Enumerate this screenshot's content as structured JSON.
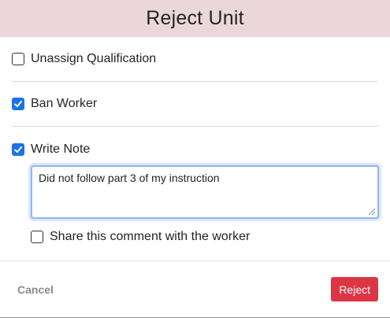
{
  "modal": {
    "title": "Reject Unit"
  },
  "options": {
    "unassign_qualification": {
      "label": "Unassign Qualification",
      "checked": false
    },
    "ban_worker": {
      "label": "Ban Worker",
      "checked": true
    },
    "write_note": {
      "label": "Write Note",
      "checked": true
    }
  },
  "note": {
    "value": "Did not follow part 3 of my instruction"
  },
  "share_comment": {
    "label": "Share this comment with the worker",
    "checked": false
  },
  "footer": {
    "cancel_label": "Cancel",
    "reject_label": "Reject"
  },
  "colors": {
    "header_bg": "#ebd7da",
    "checkbox_checked": "#1a73e8",
    "reject_button": "#dc3545"
  }
}
